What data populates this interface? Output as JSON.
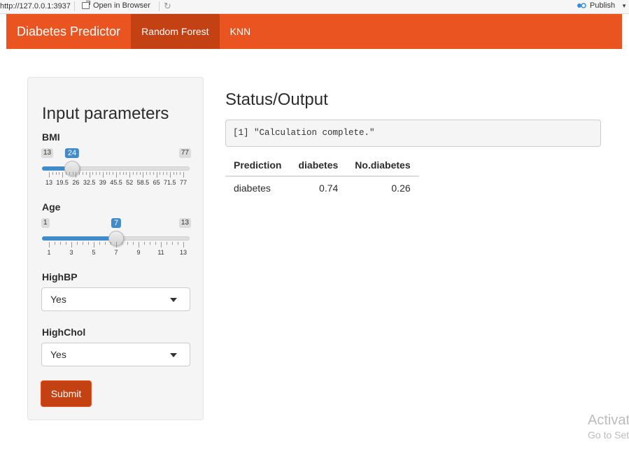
{
  "viewer": {
    "url": "http://127.0.0.1:3937",
    "open_browser_label": "Open in Browser",
    "publish_label": "Publish"
  },
  "navbar": {
    "brand": "Diabetes Predictor",
    "tabs": [
      {
        "label": "Random Forest",
        "active": true
      },
      {
        "label": "KNN",
        "active": false
      }
    ],
    "color": "#e95420",
    "active_color": "#c34113"
  },
  "sidebar": {
    "title": "Input parameters",
    "bmi": {
      "label": "BMI",
      "min": 13,
      "max": 77,
      "value": 24,
      "min_label": "13",
      "max_label": "77",
      "value_label": "24",
      "tick_labels": [
        "13",
        "19.5",
        "26",
        "32.5",
        "39",
        "45.5",
        "52",
        "58.5",
        "65",
        "71.5",
        "77"
      ]
    },
    "age": {
      "label": "Age",
      "min": 1,
      "max": 13,
      "value": 7,
      "min_label": "1",
      "max_label": "13",
      "value_label": "7",
      "tick_labels": [
        "1",
        "3",
        "5",
        "7",
        "9",
        "11",
        "13"
      ]
    },
    "highbp": {
      "label": "HighBP",
      "value": "Yes"
    },
    "highchol": {
      "label": "HighChol",
      "value": "Yes"
    },
    "submit_label": "Submit",
    "accent": "#428bca"
  },
  "main": {
    "title": "Status/Output",
    "status_text": "[1] \"Calculation complete.\"",
    "table": {
      "headers": [
        "Prediction",
        "diabetes",
        "No.diabetes"
      ],
      "rows": [
        [
          "diabetes",
          "0.74",
          "0.26"
        ]
      ]
    }
  },
  "watermark": {
    "line1": "Activate",
    "line2": "Go to Settings"
  }
}
